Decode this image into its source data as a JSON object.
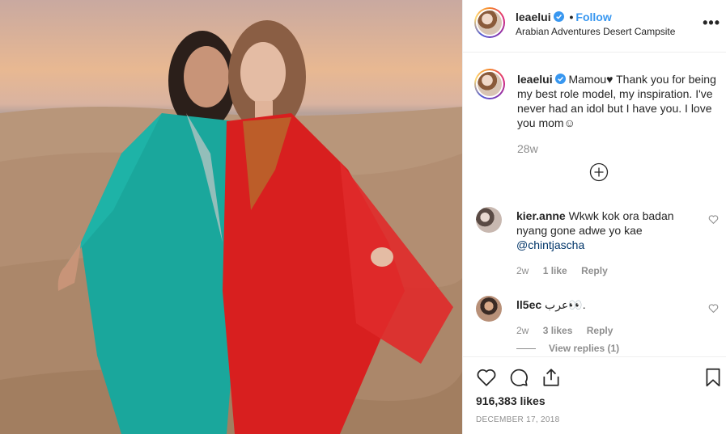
{
  "post": {
    "author": "leaelui",
    "follow_label": "Follow",
    "separator": "•",
    "location": "Arabian Adventures Desert Campsite",
    "more_label": "•••"
  },
  "caption": {
    "author": "leaelui",
    "text": "Mamou♥ Thank you for being my best role model, my inspiration. I've never had an idol but I have you. I love you mom☺",
    "time_ago": "28w"
  },
  "comments": [
    {
      "author": "kier.anne",
      "text": "Wkwk kok ora badan nyang gone adwe yo kae",
      "mention": "@chintjascha",
      "time_ago": "2w",
      "likes": "1 like",
      "reply_label": "Reply"
    },
    {
      "author": "ll5ec",
      "text": "عرب👀.",
      "time_ago": "2w",
      "likes": "3 likes",
      "reply_label": "Reply",
      "view_replies": "View replies (1)"
    }
  ],
  "stats": {
    "likes": "916,383 likes",
    "date": "DECEMBER 17, 2018"
  },
  "colors": {
    "accent": "#3897f0",
    "verified": "#3897f0",
    "secondary_text": "#8e8e8e",
    "border": "#efefef"
  },
  "icons": [
    "verified-badge-icon",
    "more-options-icon",
    "load-more-plus-icon",
    "heart-icon",
    "comment-icon",
    "share-icon",
    "bookmark-icon"
  ]
}
